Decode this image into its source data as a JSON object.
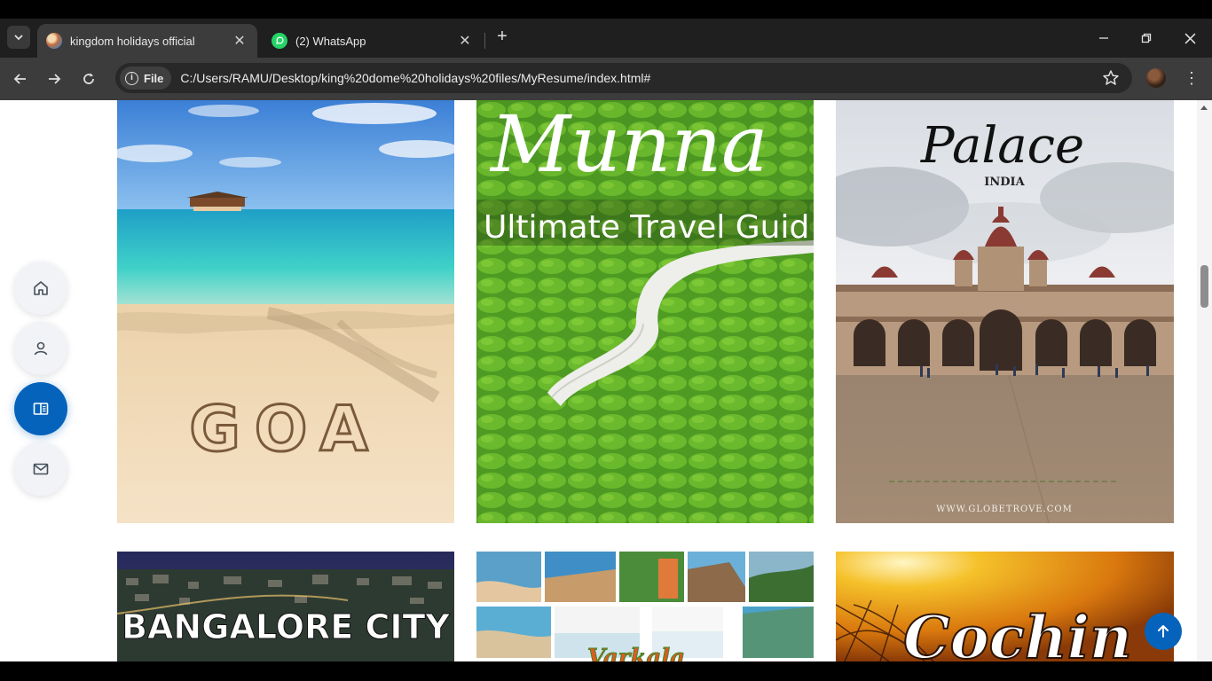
{
  "browser": {
    "tabs": [
      {
        "label": "kingdom holidays official",
        "active": true,
        "favicon": "globe-photo-icon"
      },
      {
        "label": "(2) WhatsApp",
        "active": false,
        "favicon": "whatsapp-icon"
      }
    ],
    "address": {
      "scheme_chip": "File",
      "url": "C:/Users/RAMU/Desktop/king%20dome%20holidays%20files/MyResume/index.html#"
    }
  },
  "sidenav": {
    "items": [
      {
        "name": "home",
        "icon": "house-icon",
        "active": false
      },
      {
        "name": "about",
        "icon": "person-icon",
        "active": false
      },
      {
        "name": "portfolio",
        "icon": "book-icon",
        "active": true
      },
      {
        "name": "contact",
        "icon": "envelope-icon",
        "active": false
      }
    ],
    "accent": "#0563bb"
  },
  "gallery": {
    "cards": [
      {
        "name": "goa",
        "text": "GOA"
      },
      {
        "name": "munnar",
        "script_text": "Munna",
        "subtitle": "Ultimate Travel Guid"
      },
      {
        "name": "mysore-palace",
        "script_text": "Palace",
        "country": "INDIA",
        "credit": "WWW.GLOBETROVE.COM"
      },
      {
        "name": "bangalore",
        "headline": "BANGALORE CITY"
      },
      {
        "name": "varkala",
        "partial_text": "Varkala"
      },
      {
        "name": "cochin",
        "script_text": "Cochin"
      }
    ]
  }
}
